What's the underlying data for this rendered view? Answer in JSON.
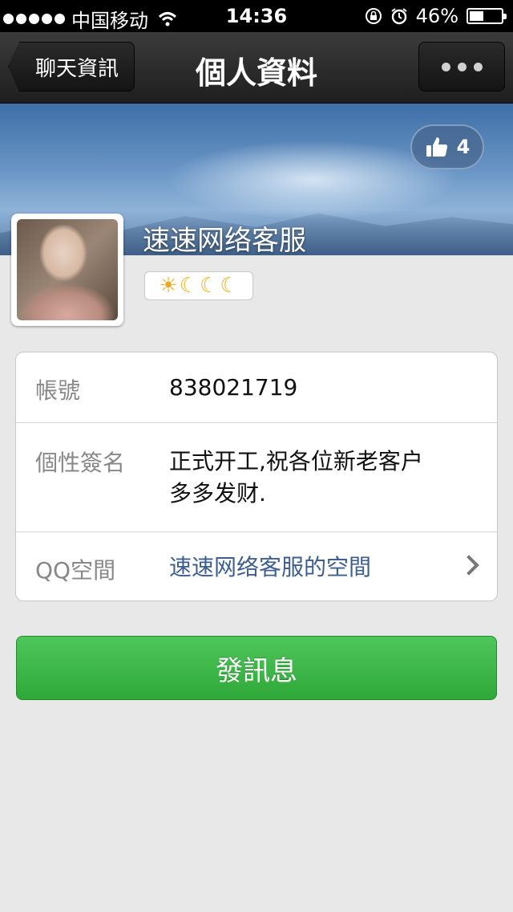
{
  "status_bar": {
    "carrier": "中国移动",
    "time": "14:36",
    "battery_percent": "46%",
    "battery_level": 0.46,
    "icons": [
      "signal-dots-icon",
      "wifi-icon",
      "orientation-lock-icon",
      "alarm-icon",
      "battery-icon"
    ]
  },
  "nav": {
    "back_label": "聊天資訊",
    "title": "個人資料",
    "more_icon": "ellipsis-icon"
  },
  "profile": {
    "like_count": "4",
    "like_icon": "thumbs-up-icon",
    "name": "速速网络客服",
    "level_icons": [
      "sun",
      "moon",
      "moon",
      "moon"
    ]
  },
  "info": {
    "rows": [
      {
        "label": "帳號",
        "value": "838021719"
      },
      {
        "label": "個性簽名",
        "value_line1": "正式开工,祝各位新老客户",
        "value_line2": "多多发财."
      },
      {
        "label": "QQ空間",
        "value": "速速网络客服的空間"
      }
    ]
  },
  "actions": {
    "send_label": "發訊息"
  },
  "colors": {
    "accent_green": "#3cb747",
    "link_blue": "#3d5e8e",
    "background": "#e8e8e8"
  }
}
